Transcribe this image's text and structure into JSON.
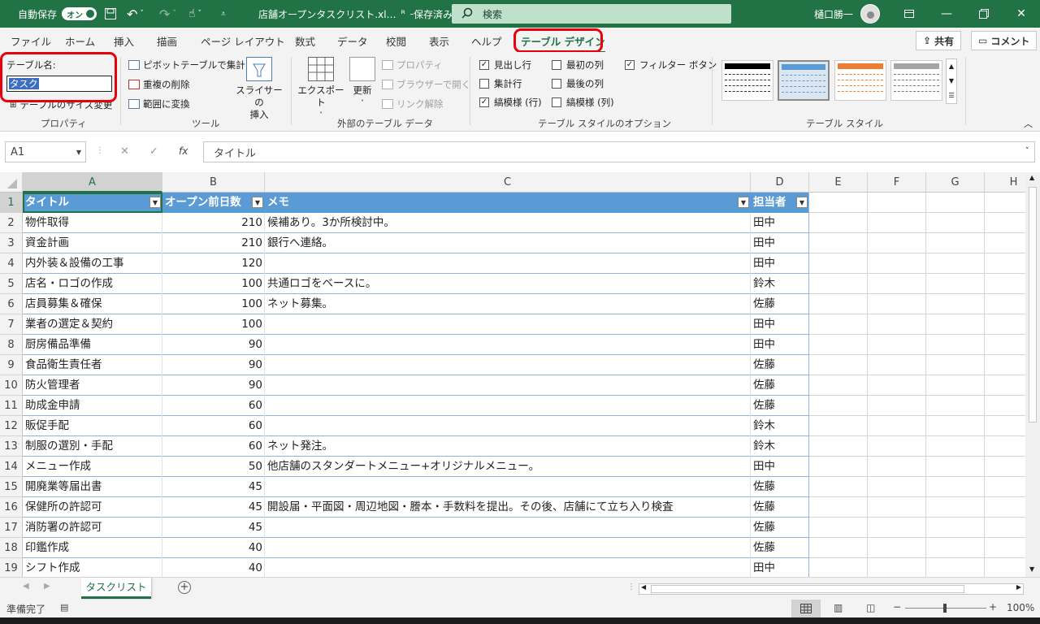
{
  "titlebar": {
    "autosave_label": "自動保存",
    "autosave_state": "オン",
    "filename": "店舗オープンタスクリスト.xl… ",
    "save_status": "保存済み",
    "search_placeholder": "検索",
    "user_name": "樋口勝一"
  },
  "ribbon_tabs": [
    "ファイル",
    "ホーム",
    "挿入",
    "描画",
    "ページ レイアウト",
    "数式",
    "データ",
    "校閲",
    "表示",
    "ヘルプ",
    "テーブル デザイン"
  ],
  "share_label": "共有",
  "comment_label": "コメント",
  "ribbon": {
    "properties": {
      "table_name_label": "テーブル名:",
      "table_name_value": "タスク",
      "resize_label": "テーブルのサイズ変更",
      "group_label": "プロパティ"
    },
    "tools": {
      "pivot_label": "ピボットテーブルで集計",
      "remove_dup_label": "重複の削除",
      "convert_label": "範囲に変換",
      "slicer_label_1": "スライサーの",
      "slicer_label_2": "挿入",
      "group_label": "ツール"
    },
    "external": {
      "export_label": "エクスポート",
      "refresh_label": "更新",
      "properties_label": "プロパティ",
      "browser_label": "ブラウザーで開く",
      "unlink_label": "リンク解除",
      "group_label": "外部のテーブル データ"
    },
    "options": {
      "header_row": "見出し行",
      "total_row": "集計行",
      "banded_rows": "縞模様 (行)",
      "first_col": "最初の列",
      "last_col": "最後の列",
      "banded_cols": "縞模様 (列)",
      "filter_btn": "フィルター ボタン",
      "group_label": "テーブル スタイルのオプション"
    },
    "styles": {
      "group_label": "テーブル スタイル"
    }
  },
  "formula_bar": {
    "cell_ref": "A1",
    "formula": "タイトル",
    "fx_label": "fx"
  },
  "columns": [
    "A",
    "B",
    "C",
    "D",
    "E",
    "F",
    "G",
    "H"
  ],
  "table": {
    "headers": [
      "タイトル",
      "オープン前日数",
      "メモ",
      "担当者"
    ],
    "rows": [
      {
        "title": "物件取得",
        "days": "210",
        "memo": "候補あり。3か所検討中。",
        "owner": "田中"
      },
      {
        "title": "資金計画",
        "days": "210",
        "memo": "銀行へ連絡。",
        "owner": "田中"
      },
      {
        "title": "内外装＆設備の工事",
        "days": "120",
        "memo": "",
        "owner": "田中"
      },
      {
        "title": "店名・ロゴの作成",
        "days": "100",
        "memo": "共通ロゴをベースに。",
        "owner": "鈴木"
      },
      {
        "title": "店員募集＆確保",
        "days": "100",
        "memo": "ネット募集。",
        "owner": "佐藤"
      },
      {
        "title": "業者の選定＆契約",
        "days": "100",
        "memo": "",
        "owner": "田中"
      },
      {
        "title": "厨房備品準備",
        "days": "90",
        "memo": "",
        "owner": "田中"
      },
      {
        "title": "食品衛生責任者",
        "days": "90",
        "memo": "",
        "owner": "佐藤"
      },
      {
        "title": "防火管理者",
        "days": "90",
        "memo": "",
        "owner": "佐藤"
      },
      {
        "title": "助成金申請",
        "days": "60",
        "memo": "",
        "owner": "佐藤"
      },
      {
        "title": "販促手配",
        "days": "60",
        "memo": "",
        "owner": "鈴木"
      },
      {
        "title": "制服の選別・手配",
        "days": "60",
        "memo": "ネット発注。",
        "owner": "鈴木"
      },
      {
        "title": "メニュー作成",
        "days": "50",
        "memo": "他店舗のスタンダートメニュー+オリジナルメニュー。",
        "owner": "田中"
      },
      {
        "title": "開廃業等届出書",
        "days": "45",
        "memo": "",
        "owner": "佐藤"
      },
      {
        "title": "保健所の許認可",
        "days": "45",
        "memo": "開設届・平面図・周辺地図・謄本・手数料を提出。その後、店舗にて立ち入り検査",
        "owner": "佐藤"
      },
      {
        "title": "消防署の許認可",
        "days": "45",
        "memo": "",
        "owner": "佐藤"
      },
      {
        "title": "印鑑作成",
        "days": "40",
        "memo": "",
        "owner": "佐藤"
      },
      {
        "title": "シフト作成",
        "days": "40",
        "memo": "",
        "owner": "田中"
      }
    ]
  },
  "sheet_tab": "タスクリスト",
  "status": {
    "ready": "準備完了",
    "zoom": "100%"
  },
  "colors": {
    "excel_green": "#217346",
    "table_header": "#5b9bd5",
    "highlight": "#e8000b"
  }
}
